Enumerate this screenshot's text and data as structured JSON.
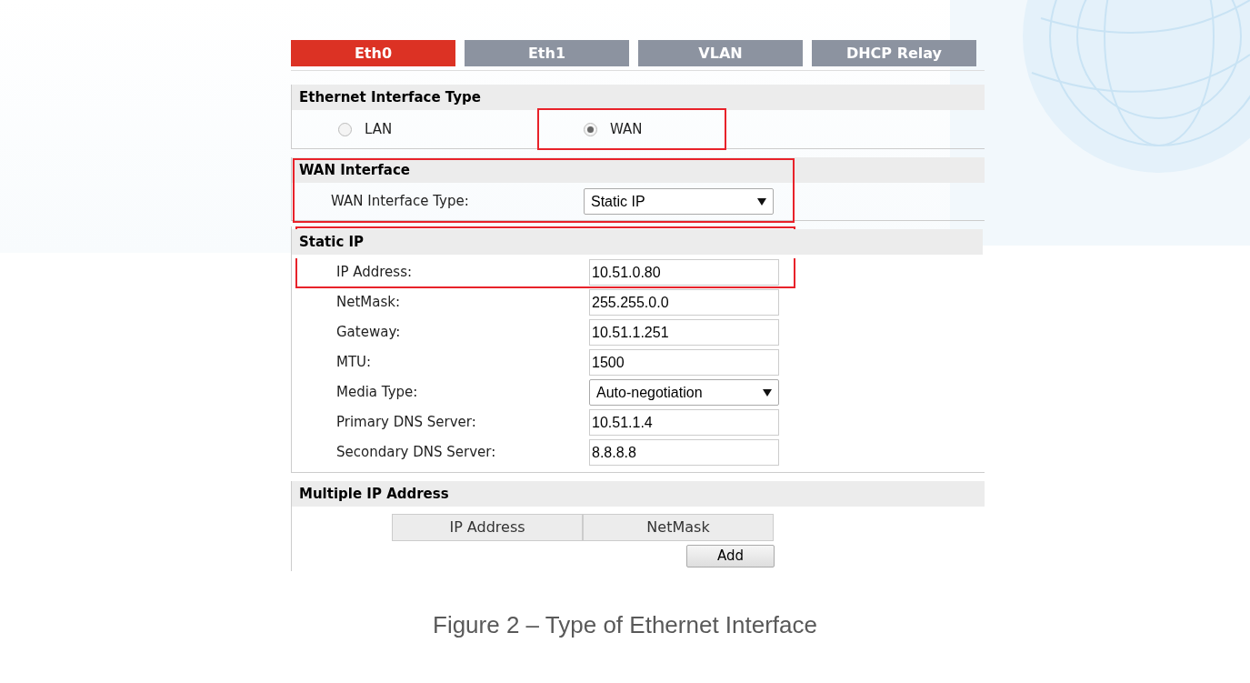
{
  "tabs": [
    {
      "label": "Eth0",
      "selected": true
    },
    {
      "label": "Eth1",
      "selected": false
    },
    {
      "label": "VLAN",
      "selected": false
    },
    {
      "label": "DHCP Relay",
      "selected": false
    }
  ],
  "interface_type": {
    "title": "Ethernet Interface Type",
    "options": [
      {
        "label": "LAN",
        "selected": false,
        "highlighted": false
      },
      {
        "label": "WAN",
        "selected": true,
        "highlighted": true
      }
    ]
  },
  "wan_interface": {
    "title": "WAN Interface",
    "highlighted": true,
    "fields": [
      {
        "kind": "select",
        "label": "WAN Interface Type:",
        "value": "Static IP"
      }
    ]
  },
  "static_ip": {
    "title": "Static IP",
    "highlighted": true,
    "fields": [
      {
        "kind": "text",
        "label": "IP Address:",
        "value": "10.51.0.80",
        "highlighted": true
      },
      {
        "kind": "text",
        "label": "NetMask:",
        "value": "255.255.0.0",
        "highlighted": false
      },
      {
        "kind": "text",
        "label": "Gateway:",
        "value": "10.51.1.251",
        "highlighted": false
      },
      {
        "kind": "text",
        "label": "MTU:",
        "value": "1500",
        "highlighted": false
      },
      {
        "kind": "select",
        "label": "Media Type:",
        "value": "Auto-negotiation",
        "highlighted": false
      },
      {
        "kind": "text",
        "label": "Primary DNS Server:",
        "value": "10.51.1.4",
        "highlighted": false
      },
      {
        "kind": "text",
        "label": "Secondary DNS Server:",
        "value": "8.8.8.8",
        "highlighted": false
      }
    ]
  },
  "multiple_ip": {
    "title": "Multiple IP Address",
    "columns": [
      "IP Address",
      "NetMask"
    ],
    "add_button": "Add"
  },
  "caption": "Figure 2 – Type of Ethernet Interface"
}
